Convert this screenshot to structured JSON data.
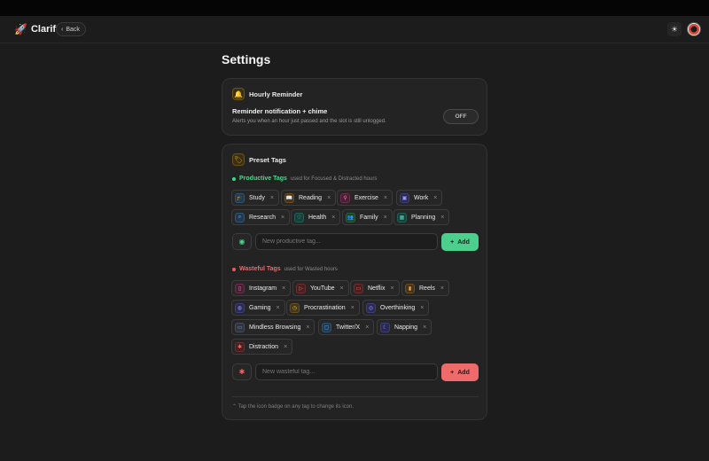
{
  "brand": {
    "name": "Clarift",
    "icon": "rocket-icon"
  },
  "header": {
    "back_label": "Back",
    "theme_icon": "sun-icon"
  },
  "page": {
    "title": "Settings"
  },
  "reminder": {
    "title": "Hourly Reminder",
    "icon": "bell-icon",
    "label": "Reminder notification + chime",
    "description": "Alerts you when an hour just passed and the slot is still unlogged.",
    "toggle_label": "OFF"
  },
  "tags": {
    "title": "Preset Tags",
    "icon": "tag-icon",
    "productive": {
      "title": "Productive Tags",
      "subtitle": "used for Focused & Distracted hours",
      "items": [
        {
          "label": "Study",
          "icon": "graduation-cap-icon"
        },
        {
          "label": "Reading",
          "icon": "book-icon"
        },
        {
          "label": "Exercise",
          "icon": "dumbbell-icon"
        },
        {
          "label": "Work",
          "icon": "briefcase-icon"
        },
        {
          "label": "Research",
          "icon": "search-icon"
        },
        {
          "label": "Health",
          "icon": "heart-icon"
        },
        {
          "label": "Family",
          "icon": "users-icon"
        },
        {
          "label": "Planning",
          "icon": "calendar-icon"
        }
      ],
      "placeholder": "New productive tag...",
      "add_label": "Add"
    },
    "wasteful": {
      "title": "Wasteful Tags",
      "subtitle": "used for Wasted hours",
      "items": [
        {
          "label": "Instagram",
          "icon": "phone-icon"
        },
        {
          "label": "YouTube",
          "icon": "play-icon"
        },
        {
          "label": "Netflix",
          "icon": "tv-icon"
        },
        {
          "label": "Reels",
          "icon": "film-icon"
        },
        {
          "label": "Gaming",
          "icon": "gamepad-icon"
        },
        {
          "label": "Procrastination",
          "icon": "clock-icon"
        },
        {
          "label": "Overthinking",
          "icon": "brain-icon"
        },
        {
          "label": "Mindless Browsing",
          "icon": "monitor-icon"
        },
        {
          "label": "Twitter/X",
          "icon": "message-icon"
        },
        {
          "label": "Napping",
          "icon": "moon-icon"
        },
        {
          "label": "Distraction",
          "icon": "bug-icon"
        }
      ],
      "placeholder": "New wasteful tag...",
      "add_label": "Add"
    },
    "hint": "Tap the icon badge on any tag to change its icon."
  },
  "colors": {
    "productive": "#4ccf8c",
    "wasteful": "#ef6a6a",
    "accent": "#e0a93a"
  }
}
